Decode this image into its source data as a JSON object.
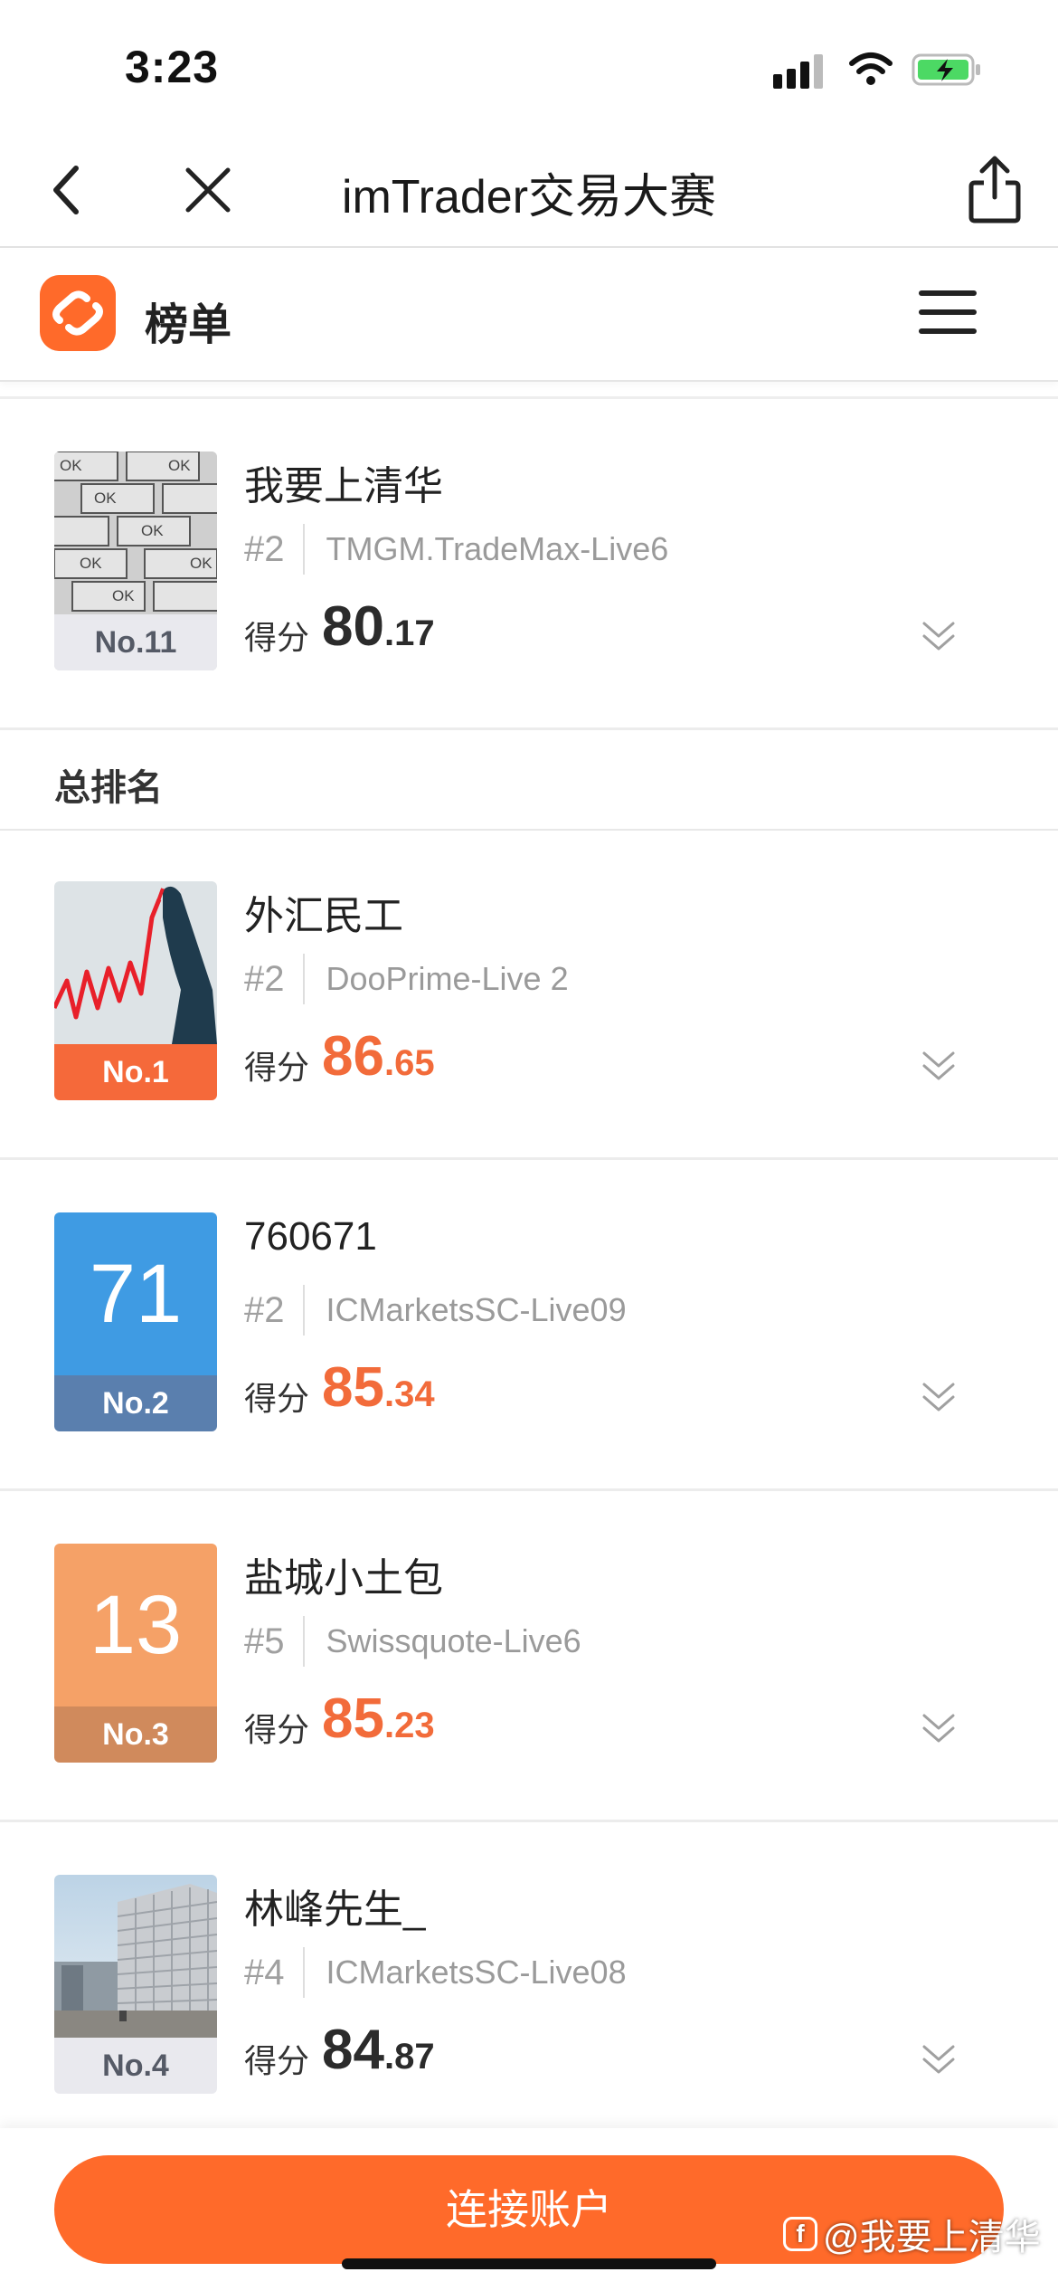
{
  "status": {
    "time": "3:23"
  },
  "nav": {
    "title": "imTrader交易大赛"
  },
  "header": {
    "title": "榜单"
  },
  "section": {
    "title": "总排名"
  },
  "items": [
    {
      "name": "我要上清华",
      "position": "#2",
      "server": "TMGM.TradeMax-Live6",
      "score_label": "得分",
      "score_int": "80",
      "score_dec": ".17",
      "rank": "No.11",
      "score_color": "#2b2b2b",
      "badge_bg": "#e9e9ee",
      "badge_color": "#555a66",
      "avatar_type": "ok-pattern",
      "avatar_tiles": [
        "OK",
        "OK",
        "OK",
        "OK",
        "OK",
        "OK",
        "OK"
      ]
    },
    {
      "name": "外汇民工",
      "position": "#2",
      "server": "DooPrime-Live 2",
      "score_label": "得分",
      "score_int": "86",
      "score_dec": ".65",
      "rank": "No.1",
      "score_color": "#f26b3a",
      "badge_bg": "#f5693a",
      "badge_color": "#ffffff",
      "avatar_type": "chart-art"
    },
    {
      "name": "760671",
      "position": "#2",
      "server": "ICMarketsSC-Live09",
      "score_label": "得分",
      "score_int": "85",
      "score_dec": ".34",
      "rank": "No.2",
      "score_color": "#f26b3a",
      "badge_bg": "#5a7fae",
      "badge_color": "#ffffff",
      "avatar_type": "number",
      "avatar_number": "71",
      "avatar_bg": "#3f9be3"
    },
    {
      "name": "盐城小土包",
      "position": "#5",
      "server": "Swissquote-Live6",
      "score_label": "得分",
      "score_int": "85",
      "score_dec": ".23",
      "rank": "No.3",
      "score_color": "#f26b3a",
      "badge_bg": "#d08a5c",
      "badge_color": "#ffffff",
      "avatar_type": "number",
      "avatar_number": "13",
      "avatar_bg": "#f5a167"
    },
    {
      "name": "林峰先生_",
      "position": "#4",
      "server": "ICMarketsSC-Live08",
      "score_label": "得分",
      "score_int": "84",
      "score_dec": ".87",
      "rank": "No.4",
      "score_color": "#2b2b2b",
      "badge_bg": "#e9e9ee",
      "badge_color": "#555a66",
      "avatar_type": "building"
    }
  ],
  "bottom": {
    "button_label": "连接账户",
    "watermark": "@我要上清华"
  },
  "icons": [
    "back-icon",
    "close-icon",
    "share-icon",
    "menu-icon",
    "chevron-double-down-icon",
    "app-logo-icon"
  ],
  "colors": {
    "accent": "#ff6a2a"
  }
}
